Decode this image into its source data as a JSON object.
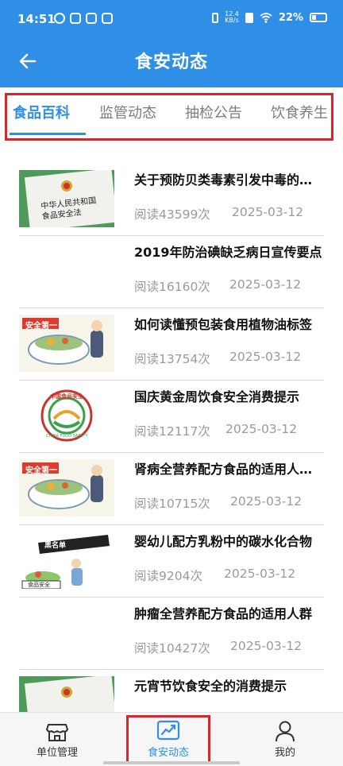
{
  "status_bar": {
    "time": "14:51",
    "speed": "12.4\nKB/s",
    "battery": "22%"
  },
  "header": {
    "title": "食安动态",
    "back_icon": "arrow-left-icon",
    "color": "#2f8ee6"
  },
  "tabs": [
    {
      "label": "食品百科",
      "active": true
    },
    {
      "label": "监管动态",
      "active": false
    },
    {
      "label": "抽检公告",
      "active": false
    },
    {
      "label": "饮食养生",
      "active": false
    }
  ],
  "articles": [
    {
      "title": "关于预防贝类毒素引发中毒的消费提示",
      "reads": "阅读43599次",
      "date": "2025-03-12",
      "thumb": "law-book"
    },
    {
      "title": "2019年防治碘缺乏病日宣传要点",
      "reads": "阅读16160次",
      "date": "2025-03-12",
      "thumb": "none"
    },
    {
      "title": "如何读懂预包装食用植物油标签",
      "reads": "阅读13754次",
      "date": "2025-03-12",
      "thumb": "safety-bowl"
    },
    {
      "title": "国庆黄金周饮食安全消费提示",
      "reads": "阅读12117次",
      "date": "2025-03-12",
      "thumb": "china-food-logo"
    },
    {
      "title": "肾病全营养配方食品的适用人群及注意事项",
      "reads": "阅读10715次",
      "date": "2025-03-12",
      "thumb": "safety-bowl"
    },
    {
      "title": "婴幼儿配方乳粉中的碳水化合物",
      "reads": "阅读9204次",
      "date": "2025-03-12",
      "thumb": "blacklist"
    },
    {
      "title": "肿瘤全营养配方食品的适用人群",
      "reads": "阅读10427次",
      "date": "2025-03-12",
      "thumb": "none"
    },
    {
      "title": "元宵节饮食安全的消费提示",
      "reads": "",
      "date": "",
      "thumb": "law-book"
    }
  ],
  "thumb_text": {
    "law_book": "中华人民共和国\n食品安全法",
    "safety_first": "安全第一",
    "china_food_top": "中国食品安全",
    "china_food_bottom": "CHINA FOOD SAFETY",
    "blacklist": "黑名单",
    "food_safety": "食品安全"
  },
  "bottom_nav": [
    {
      "label": "单位管理",
      "icon": "store-icon",
      "active": false
    },
    {
      "label": "食安动态",
      "icon": "trend-chart-icon",
      "active": true
    },
    {
      "label": "我的",
      "icon": "user-icon",
      "active": false
    }
  ]
}
